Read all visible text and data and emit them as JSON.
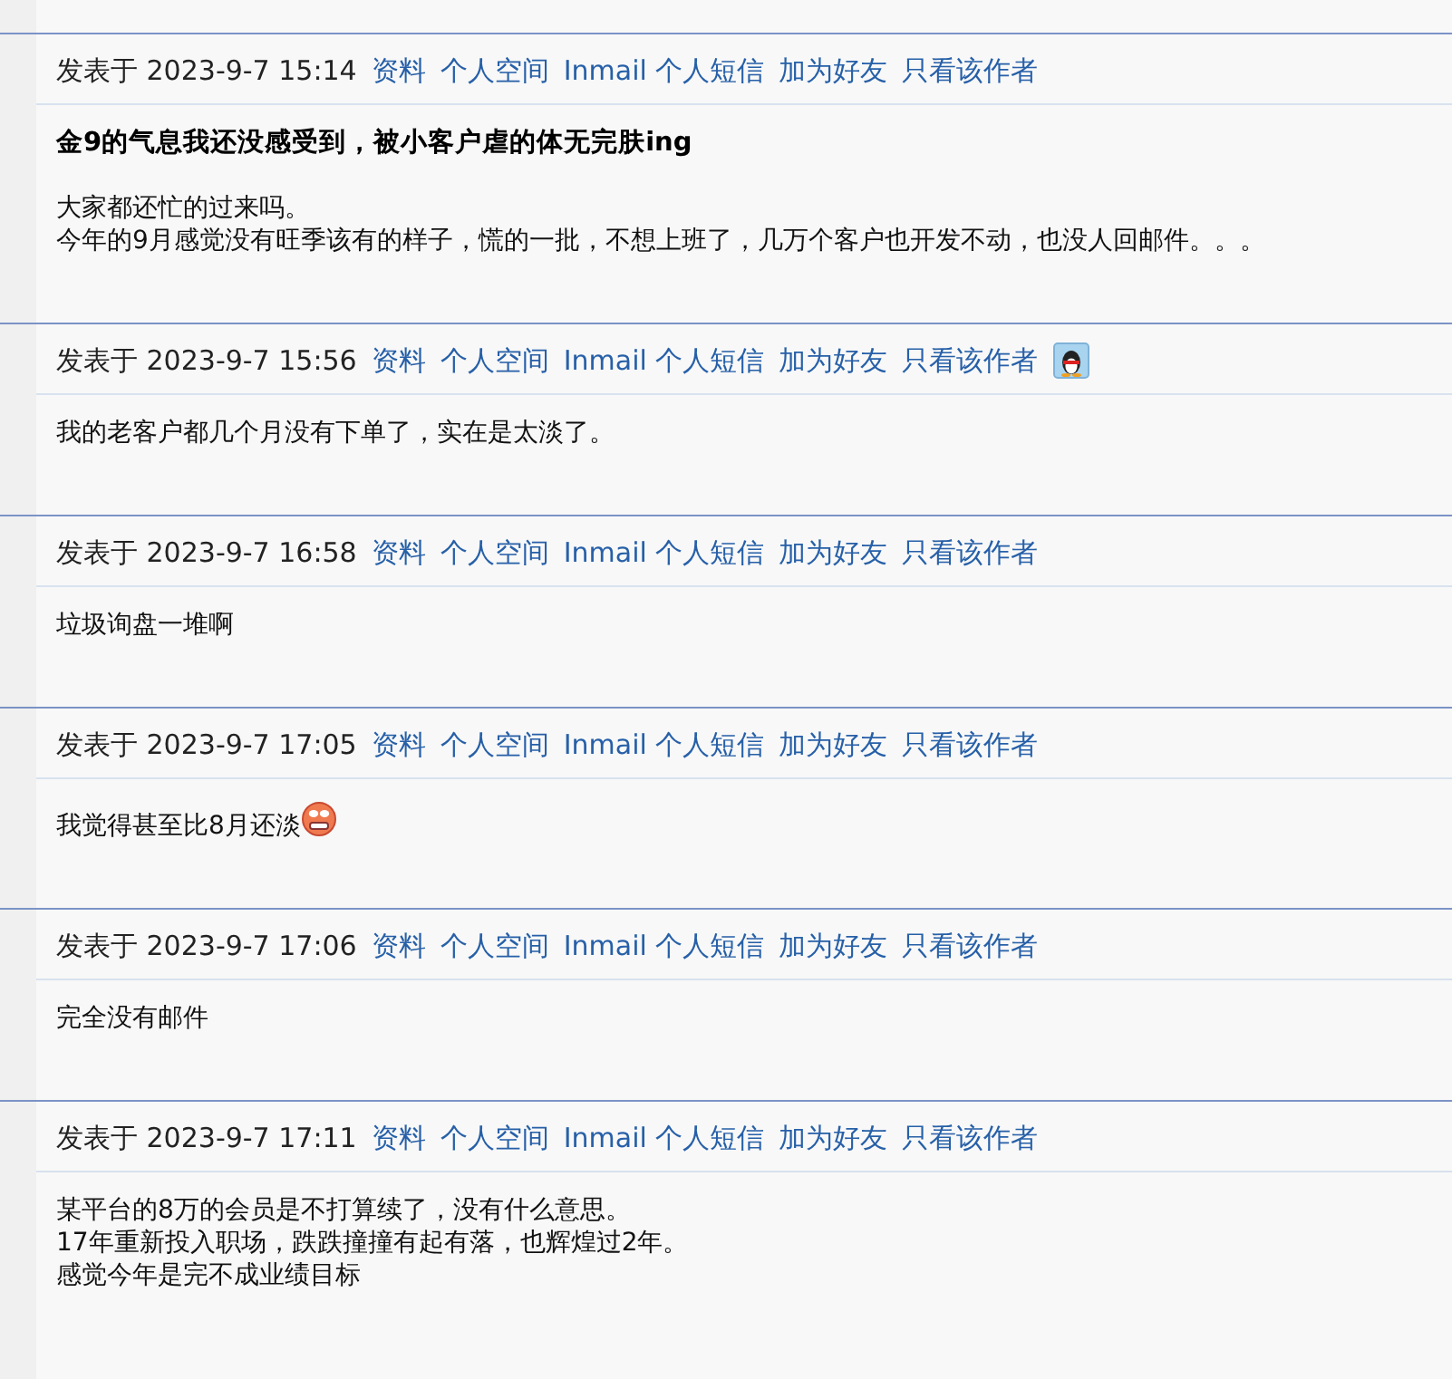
{
  "posts": [
    {
      "posted_label": "发表于",
      "date": "2023-9-7 15:14",
      "links": [
        "资料",
        "个人空间",
        "Inmail 个人短信",
        "加为好友",
        "只看该作者"
      ],
      "qq_icon": false,
      "title": "金9的气息我还没感受到，被小客户虐的体无完肤ing",
      "body": [
        "大家都还忙的过来吗。",
        "今年的9月感觉没有旺季该有的样子，慌的一批，不想上班了，几万个客户也开发不动，也没人回邮件。。。"
      ],
      "emoticon": false
    },
    {
      "posted_label": "发表于",
      "date": "2023-9-7 15:56",
      "links": [
        "资料",
        "个人空间",
        "Inmail 个人短信",
        "加为好友",
        "只看该作者"
      ],
      "qq_icon": true,
      "body": [
        "我的老客户都几个月没有下单了，实在是太淡了。"
      ],
      "emoticon": false
    },
    {
      "posted_label": "发表于",
      "date": "2023-9-7 16:58",
      "links": [
        "资料",
        "个人空间",
        "Inmail 个人短信",
        "加为好友",
        "只看该作者"
      ],
      "qq_icon": false,
      "body": [
        "垃圾询盘一堆啊"
      ],
      "emoticon": false
    },
    {
      "posted_label": "发表于",
      "date": "2023-9-7 17:05",
      "links": [
        "资料",
        "个人空间",
        "Inmail 个人短信",
        "加为好友",
        "只看该作者"
      ],
      "qq_icon": false,
      "body": [
        "我觉得甚至比8月还淡"
      ],
      "emoticon": true
    },
    {
      "posted_label": "发表于",
      "date": "2023-9-7 17:06",
      "links": [
        "资料",
        "个人空间",
        "Inmail 个人短信",
        "加为好友",
        "只看该作者"
      ],
      "qq_icon": false,
      "body": [
        "完全没有邮件"
      ],
      "emoticon": false
    },
    {
      "posted_label": "发表于",
      "date": "2023-9-7 17:11",
      "links": [
        "资料",
        "个人空间",
        "Inmail 个人短信",
        "加为好友",
        "只看该作者"
      ],
      "qq_icon": false,
      "body": [
        "某平台的8万的会员是不打算续了，没有什么意思。",
        "17年重新投入职场，跌跌撞撞有起有落，也辉煌过2年。",
        "感觉今年是完不成业绩目标"
      ],
      "emoticon": false
    }
  ]
}
